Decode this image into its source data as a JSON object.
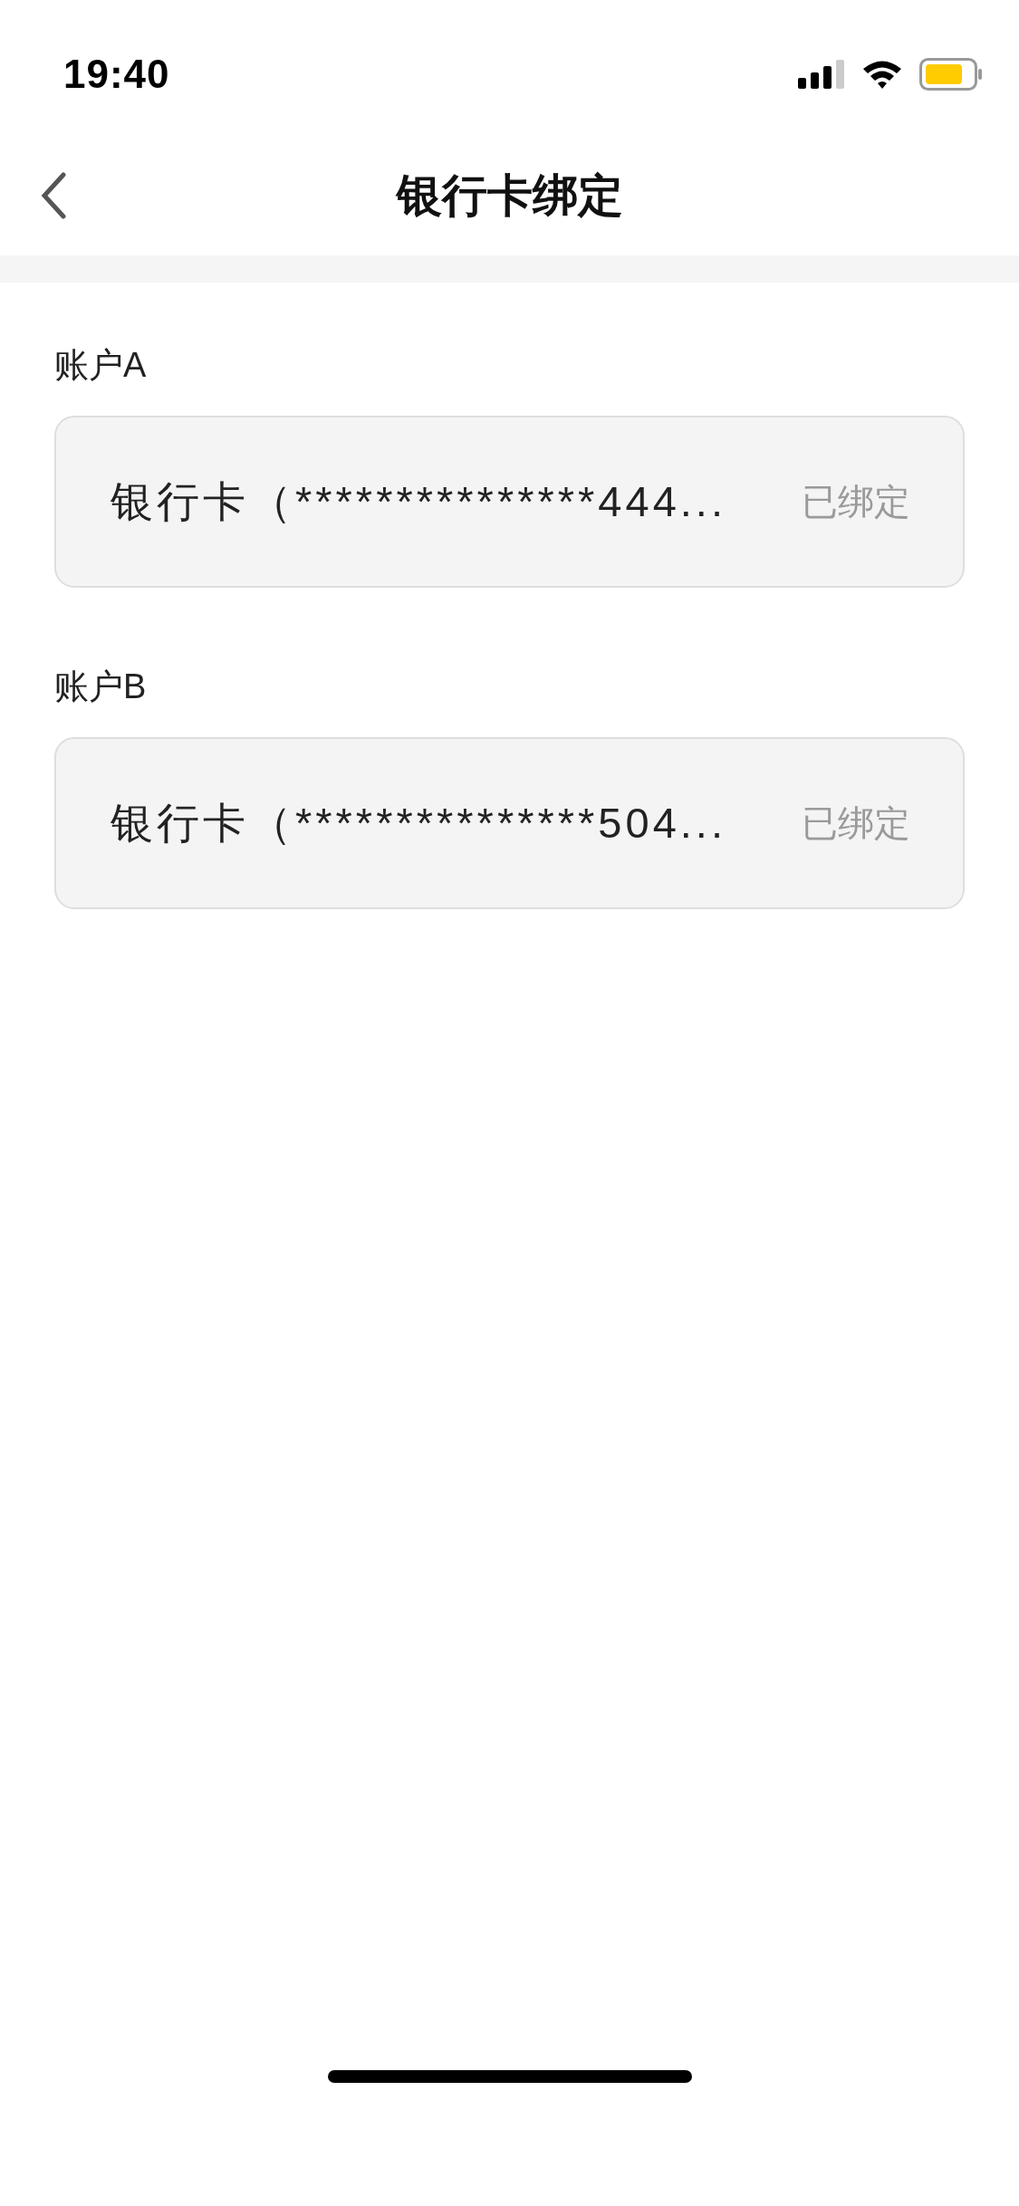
{
  "status_bar": {
    "time": "19:40"
  },
  "nav": {
    "title": "银行卡绑定"
  },
  "accounts": [
    {
      "label": "账户A",
      "card": "银行卡（***************444...",
      "status": "已绑定"
    },
    {
      "label": "账户B",
      "card": "银行卡（***************504...",
      "status": "已绑定"
    }
  ]
}
